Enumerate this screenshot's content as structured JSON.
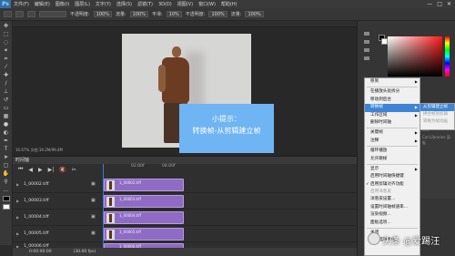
{
  "menubar": {
    "logo": "Ps",
    "items": [
      "文件(F)",
      "编辑(E)",
      "图像(I)",
      "图层(L)",
      "文字(Y)",
      "选择(S)",
      "滤镜(T)",
      "3D(D)",
      "视图(V)",
      "窗口(W)",
      "帮助(H)"
    ],
    "window_buttons": [
      "—",
      "□",
      "✕"
    ]
  },
  "options": {
    "mode_label": "不透明度:",
    "mode_value": "100%",
    "flow_label": "流量:",
    "flow_value": "100%",
    "smooth_label": "平滑:",
    "smooth_value": "10%",
    "opacity2_label": "不透明度:",
    "opacity2_value": "100%",
    "flow2_label": "流量:",
    "flow2_value": "100%"
  },
  "status": "16.67%    文档:19.2M/99.4M",
  "hint": {
    "line1": "小提示：",
    "line2": "转换帧-从剪辑建立帧"
  },
  "timeline": {
    "title": "时间轴",
    "controls": [
      "⏮",
      "◀",
      "▶",
      "▶|",
      "🔇",
      "✂"
    ],
    "ruler_labels": [
      "02:00f",
      "04:00f"
    ],
    "layers": [
      {
        "name": "1_00002.tiff",
        "clip": "1_00002.tiff"
      },
      {
        "name": "1_00003.tiff",
        "clip": "1_00003.tiff"
      },
      {
        "name": "1_00004.tiff",
        "clip": "1_00004.tiff"
      },
      {
        "name": "1_00005.tiff",
        "clip": "1_00005.tiff"
      },
      {
        "name": "1_00006.tiff",
        "clip": "1_00006.tiff"
      }
    ],
    "footer": [
      "0:00:00:00",
      "(30.00 fps)"
    ]
  },
  "context_menu": {
    "items": [
      {
        "label": "移到",
        "arrow": true
      },
      {
        "label": "在播放头处拆分",
        "sep_before": true
      },
      {
        "label": "移动到后台"
      },
      {
        "label": "转换帧",
        "highlight": true,
        "arrow": true
      },
      {
        "label": "工作区域",
        "arrow": true
      },
      {
        "label": "删除时间轴"
      },
      {
        "label": "关键帧",
        "arrow": true,
        "sep_before": true
      },
      {
        "label": "注释",
        "arrow": true
      },
      {
        "label": "循环播放",
        "sep_before": true
      },
      {
        "label": "允许跳帧"
      },
      {
        "label": "显示",
        "arrow": true,
        "sep_before": true
      },
      {
        "label": "启用时间轴快捷键"
      },
      {
        "label": "启用剪辑对齐功能",
        "checked": true
      },
      {
        "label": "启用洋葱皮",
        "disabled": true
      },
      {
        "label": "洋葱皮设置..."
      },
      {
        "label": "设置时间轴帧速率..."
      },
      {
        "label": "渲染视频..."
      },
      {
        "label": "面板选项..."
      },
      {
        "label": "关闭",
        "sep_before": true
      },
      {
        "label": "关闭选项卡组"
      }
    ]
  },
  "submenu": {
    "items": [
      {
        "label": "从剪辑建立帧",
        "highlight": true
      },
      {
        "label": "拼合帧到剪辑",
        "disabled": true
      },
      {
        "label": "转换为帧动画",
        "disabled": true
      }
    ]
  },
  "layerpanel": [
    "类型",
    "正常",
    "锁定",
    "Cut Libraries 面板"
  ],
  "watermark": {
    "text": "头条 @爱踢汪"
  },
  "colors": {
    "accent": "#3d84d6",
    "clip": "#8e6bc4",
    "hint_bg": "#6fb4f3"
  }
}
